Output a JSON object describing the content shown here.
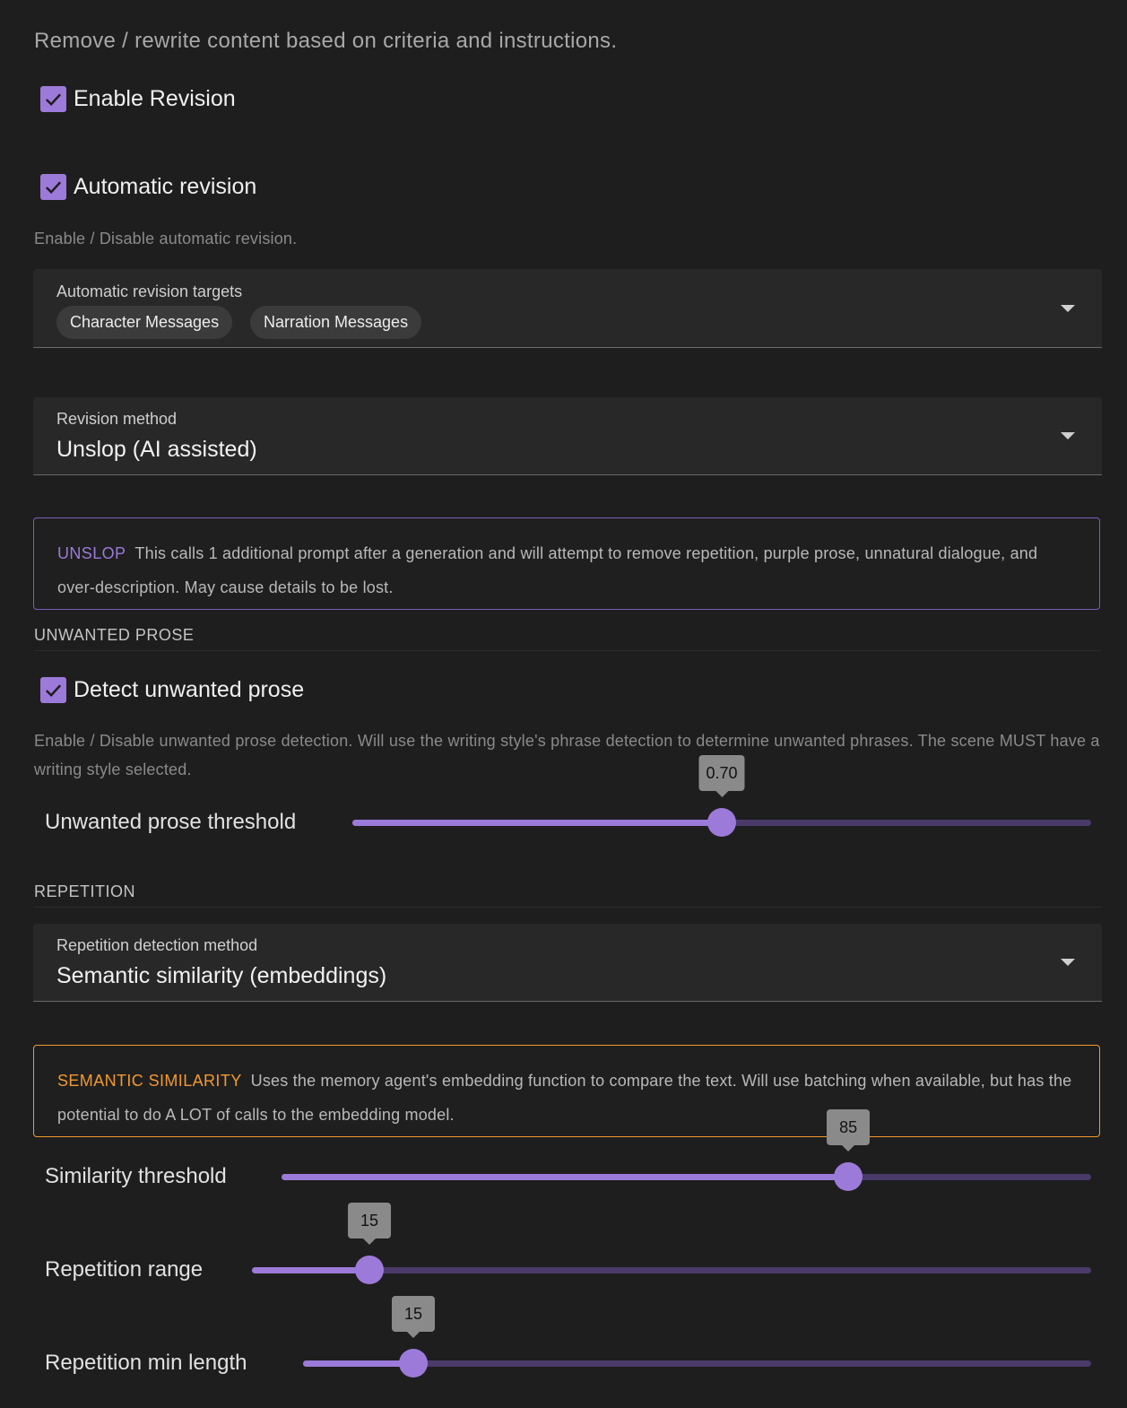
{
  "intro": "Remove / rewrite content based on criteria and instructions.",
  "enable_revision": {
    "label": "Enable Revision",
    "checked": true
  },
  "automatic_revision": {
    "label": "Automatic revision",
    "checked": true,
    "help": "Enable / Disable automatic revision."
  },
  "targets": {
    "label": "Automatic revision targets",
    "chips": [
      "Character Messages",
      "Narration Messages"
    ]
  },
  "revision_method": {
    "label": "Revision method",
    "value": "Unslop (AI assisted)"
  },
  "unslop_alert": {
    "tag": "UNSLOP",
    "text": "This calls 1 additional prompt after a generation and will attempt to remove repetition, purple prose, unnatural dialogue, and over-description. May cause details to be lost.",
    "color": "#9c7ad9"
  },
  "unwanted_prose": {
    "section": "UNWANTED PROSE",
    "detect_label": "Detect unwanted prose",
    "detect_checked": true,
    "help": "Enable / Disable unwanted prose detection. Will use the writing style's phrase detection to determine unwanted phrases. The scene MUST have a writing style selected.",
    "threshold_label": "Unwanted prose threshold",
    "threshold_value": "0.70",
    "threshold_fraction": 0.5
  },
  "repetition": {
    "section": "REPETITION",
    "method_label": "Repetition detection method",
    "method_value": "Semantic similarity (embeddings)"
  },
  "semantic_alert": {
    "tag": "SEMANTIC SIMILARITY",
    "text": "Uses the memory agent's embedding function to compare the text. Will use batching when available, but has the potential to do A LOT of calls to the embedding model.",
    "color": "#f29a2e"
  },
  "sliders": {
    "similarity": {
      "label": "Similarity threshold",
      "value": "85",
      "fraction": 0.7
    },
    "range": {
      "label": "Repetition range",
      "value": "15",
      "fraction": 0.14
    },
    "min_length": {
      "label": "Repetition min length",
      "value": "15",
      "fraction": 0.14
    }
  },
  "colors": {
    "accent": "#9c7ad9",
    "accent_track": "#4a3a6a",
    "warning": "#f29a2e",
    "background": "#1e1e1e"
  },
  "icons": {
    "checkbox": "check-icon",
    "dropdown": "chevron-down-icon"
  }
}
